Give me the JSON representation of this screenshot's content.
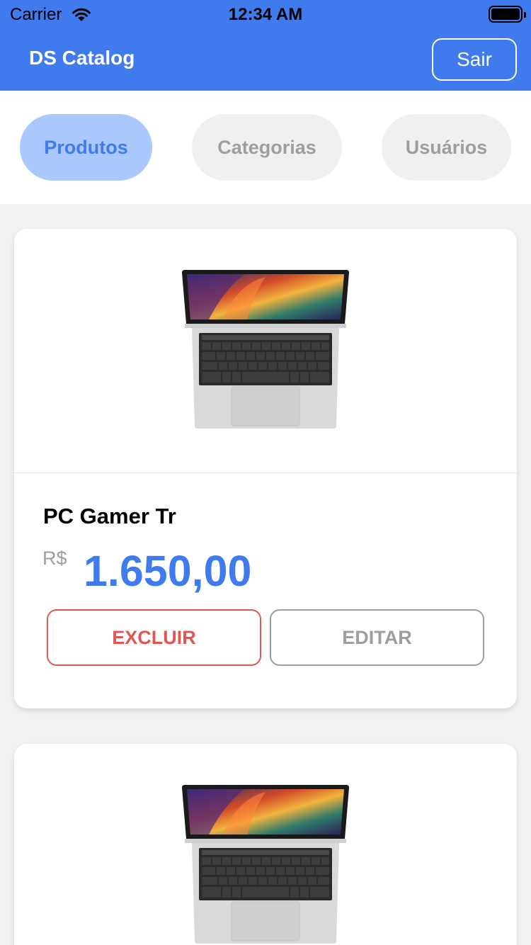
{
  "status_bar": {
    "carrier": "Carrier",
    "time": "12:34 AM"
  },
  "header": {
    "title": "DS Catalog",
    "logout_label": "Sair"
  },
  "tabs": [
    {
      "label": "Produtos",
      "active": true
    },
    {
      "label": "Categorias",
      "active": false
    },
    {
      "label": "Usuários",
      "active": false
    }
  ],
  "products": [
    {
      "name": "PC Gamer Tr",
      "currency": "R$",
      "price": "1.650,00",
      "delete_label": "EXCLUIR",
      "edit_label": "EDITAR",
      "image": "laptop"
    },
    {
      "image": "laptop"
    }
  ],
  "colors": {
    "primary": "#407BEE",
    "tab_active_bg": "#A9C8FB",
    "danger": "#DF5753",
    "muted": "#9E9E9E",
    "background": "#F2F2F2"
  }
}
